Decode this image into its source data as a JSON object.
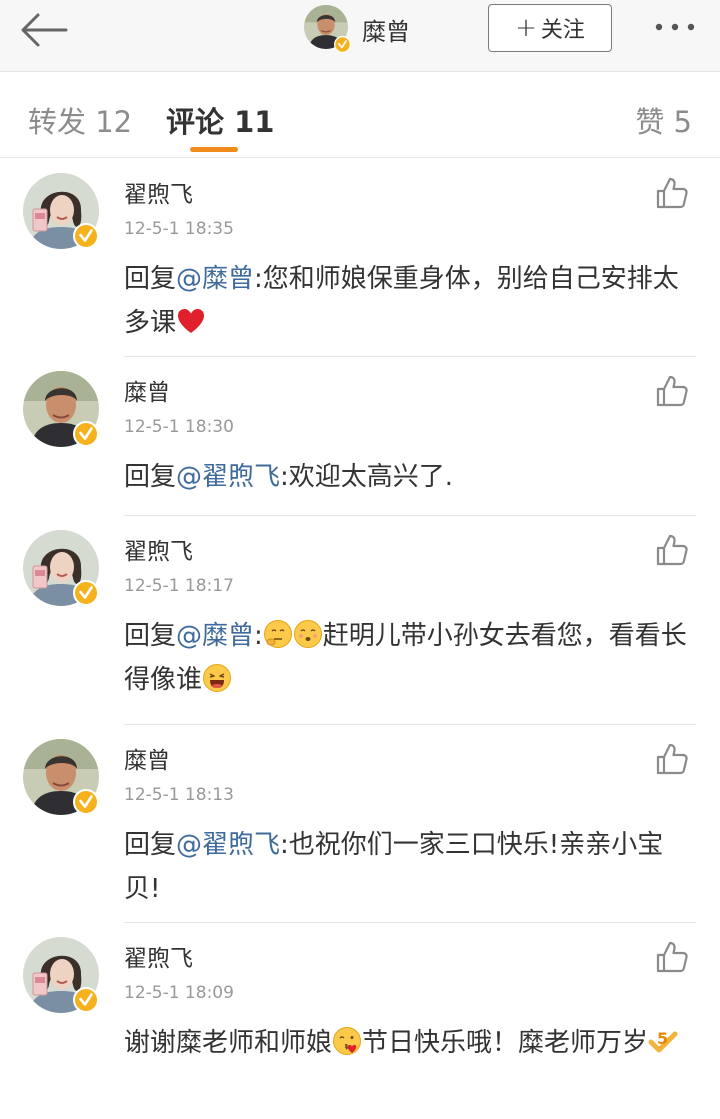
{
  "header": {
    "author_name": "糜曾",
    "follow_plus": "+",
    "follow_label": "关注"
  },
  "tabs": [
    {
      "label": "转发 12"
    },
    {
      "label": "评论 11"
    },
    {
      "label": "赞 5"
    }
  ],
  "colors": {
    "accent": "#f08c1b",
    "mention": "#3f6b9c",
    "verified": "#f5b21c",
    "heart": "#e0202a"
  },
  "icons": [
    "back-arrow-icon",
    "more-dots-icon",
    "verified-badge-icon",
    "thumbs-up-icon",
    "heart-emoji-icon",
    "thinking-emoji-icon",
    "wink-emoji-icon",
    "laughing-emoji-icon",
    "blowing-kiss-emoji-icon",
    "number-five-emoji-icon"
  ],
  "comments": [
    {
      "name": "翟煦飞",
      "time": "12-5-1 18:35",
      "prefix": "回复",
      "mention": "@糜曾",
      "text_before": ":您和师娘保重身体，别给自己安排太多课",
      "text_after": ""
    },
    {
      "name": "糜曾",
      "time": "12-5-1 18:30",
      "prefix": "回复",
      "mention": "@翟煦飞",
      "text_before": ":欢迎太高兴了.",
      "text_after": ""
    },
    {
      "name": "翟煦飞",
      "time": "12-5-1 18:17",
      "prefix": "回复",
      "mention": "@糜曾",
      "text_before": ":",
      "text_after": "赶明儿带小孙女去看您，看看长得像谁"
    },
    {
      "name": "糜曾",
      "time": "12-5-1 18:13",
      "prefix": "回复",
      "mention": "@翟煦飞",
      "text_before": ":也祝你们一家三口快乐!亲亲小宝贝!",
      "text_after": ""
    },
    {
      "name": "翟煦飞",
      "time": "12-5-1 18:09",
      "prefix": "",
      "mention": "",
      "text_before": "谢谢糜老师和师娘",
      "text_after": "节日快乐哦！糜老师万岁"
    }
  ]
}
